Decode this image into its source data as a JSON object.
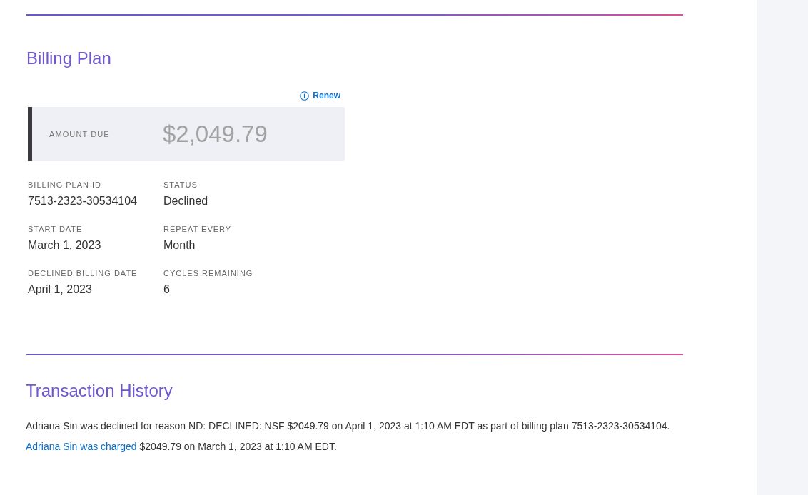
{
  "billing_plan": {
    "title": "Billing Plan",
    "renew_action": "Renew",
    "amount_due": {
      "label": "AMOUNT DUE",
      "value": "$2,049.79"
    },
    "details": [
      {
        "label": "BILLING PLAN ID",
        "value": "7513-2323-30534104"
      },
      {
        "label": "STATUS",
        "value": "Declined"
      },
      {
        "label": "START DATE",
        "value": "March 1, 2023"
      },
      {
        "label": "REPEAT EVERY",
        "value": "Month"
      },
      {
        "label": "DECLINED BILLING DATE",
        "value": "April 1, 2023"
      },
      {
        "label": "CYCLES REMAINING",
        "value": "6"
      }
    ]
  },
  "transaction_history": {
    "title": "Transaction History",
    "entries": [
      {
        "kind": "plain",
        "text": "Adriana Sin was declined for reason ND: DECLINED: NSF $2049.79 on April 1, 2023 at 1:10 AM EDT as part of billing plan 7513-2323-30534104."
      },
      {
        "kind": "linked",
        "link": "Adriana Sin was charged",
        "text": "$2049.79 on March 1, 2023 at 1:10 AM EDT."
      }
    ]
  }
}
